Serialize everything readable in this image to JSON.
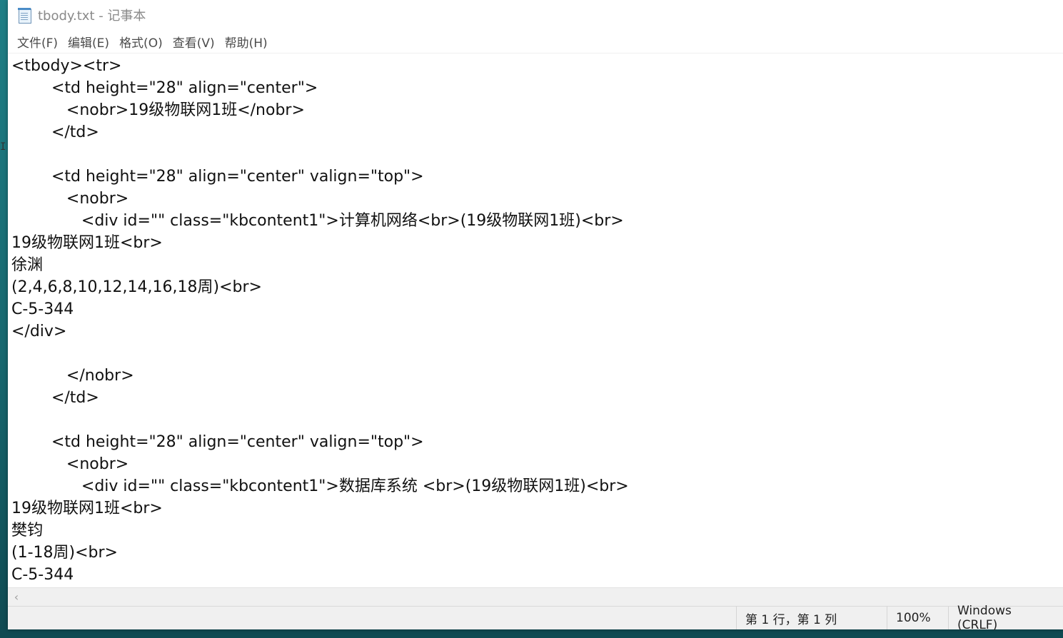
{
  "window": {
    "title": "tbody.txt - 记事本"
  },
  "menu": {
    "file": "文件(F)",
    "edit": "编辑(E)",
    "format": "格式(O)",
    "view": "查看(V)",
    "help": "帮助(H)"
  },
  "editor": {
    "text": "<tbody><tr>\n\t<td height=\"28\" align=\"center\">\n\t   <nobr>19级物联网1班</nobr>\n\t</td>\n\n\t<td height=\"28\" align=\"center\" valign=\"top\">\n\t   <nobr>\n\t      <div id=\"\" class=\"kbcontent1\">计算机网络<br>(19级物联网1班)<br>\n19级物联网1班<br>\n徐渊\n(2,4,6,8,10,12,14,16,18周)<br>\nC-5-344\n</div>\n\n\t   </nobr>\n\t</td>\n\n\t<td height=\"28\" align=\"center\" valign=\"top\">\n\t   <nobr>\n\t      <div id=\"\" class=\"kbcontent1\">数据库系统 <br>(19级物联网1班)<br>\n19级物联网1班<br>\n樊钧\n(1-18周)<br>\nC-5-344"
  },
  "scrollbar": {
    "left_arrow": "‹"
  },
  "status": {
    "position": "第 1 行，第 1 列",
    "zoom": "100%",
    "line_ending": "Windows (CRLF)"
  },
  "icons": {
    "app": "notepad-icon",
    "text_cursor": "ibeam-cursor-icon"
  }
}
